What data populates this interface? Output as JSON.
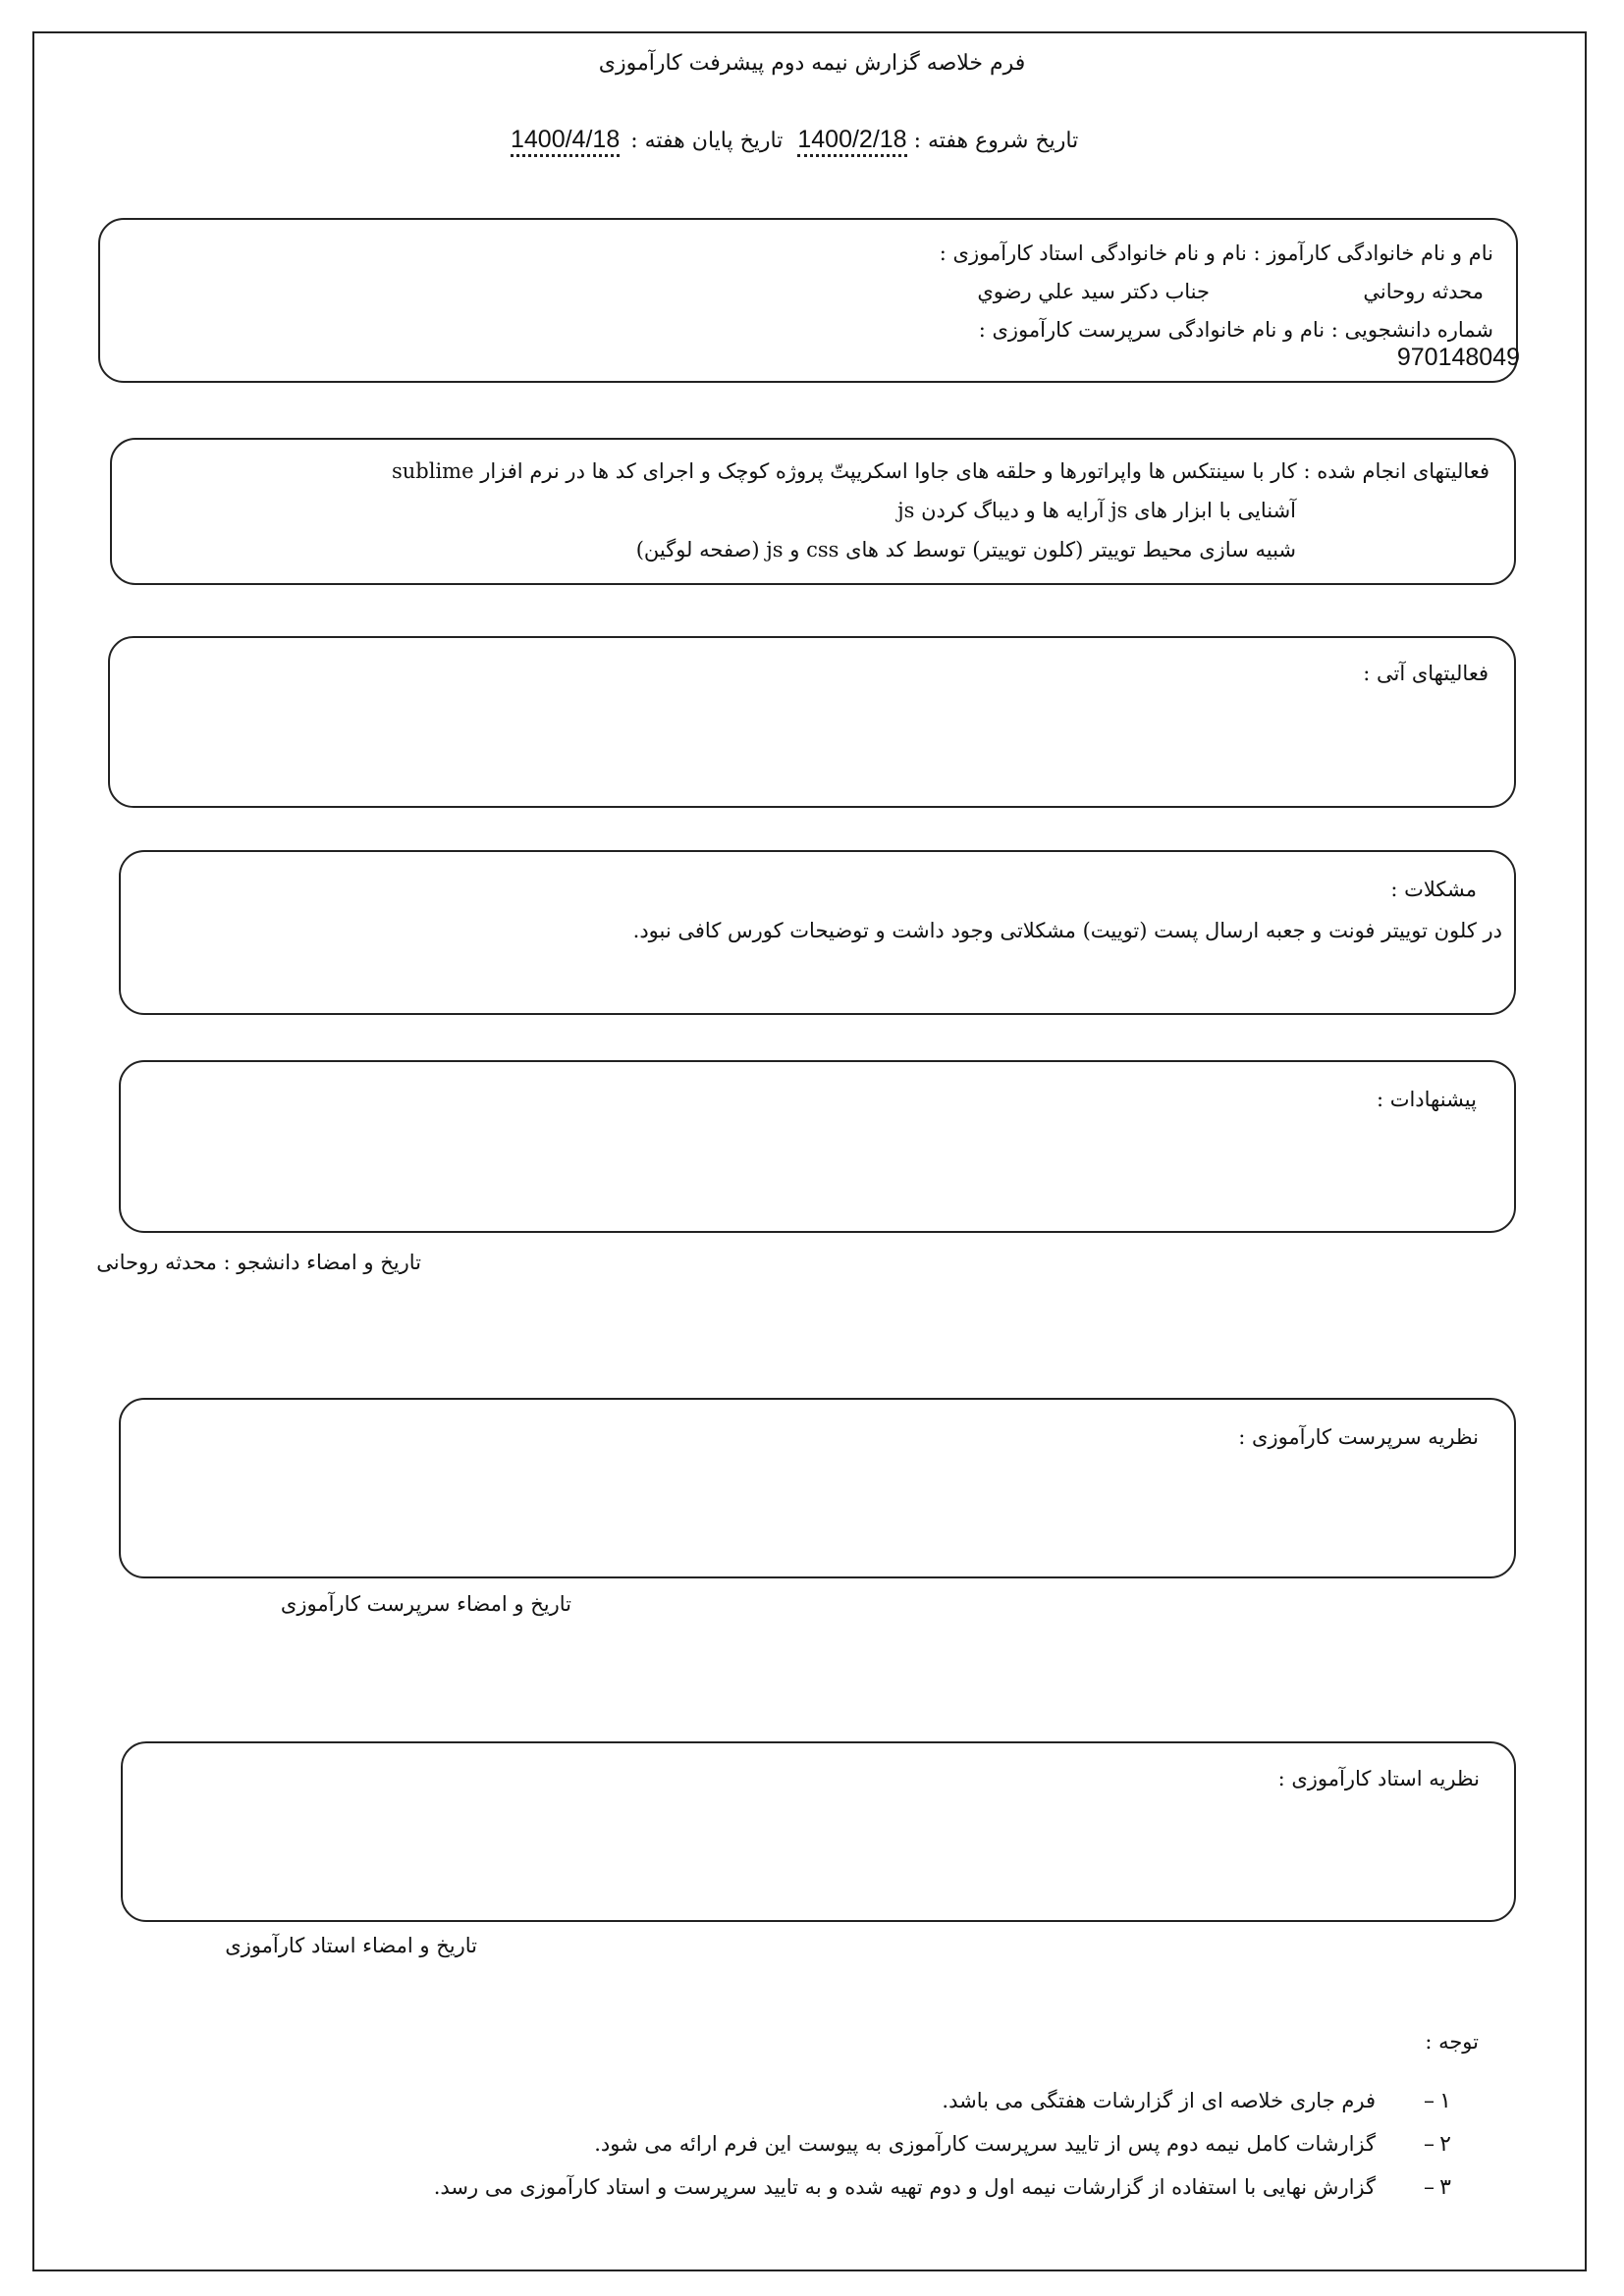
{
  "form": {
    "title": "فرم خلاصه گزارش نیمه دوم پیشرفت کارآموزی",
    "start_label": "تاریخ شروع هفته :",
    "start_date": "1400/2/18",
    "end_label": "تاریخ پایان هفته :",
    "end_date": "1400/4/18"
  },
  "info": {
    "names_label": "نام و نام خانوادگی کارآموز :    نام و نام خانوادگی استاد کارآموزی :",
    "student_name": "محدثه روحاني",
    "professor_name": "جناب دكتر سيد علي رضوي",
    "id_label": "شماره دانشجویی :    نام و نام خانوادگی سرپرست کارآموزی :",
    "student_id": "970148049"
  },
  "activities": {
    "label": "فعالیتهای انجام شده :",
    "line1": "کار با سینتکس ها واپراتورها و حلقه های جاوا اسکریپتّ  پروژه کوچک و اجرای کد ها در نرم افزار sublime",
    "line2": "آشنایی با ابزار های js   آرایه ها و دیباگ کردن js",
    "line3": "شبیه سازی محیط توییتر (کلون توییتر) توسط کد های css و js  (صفحه لوگین)"
  },
  "future": {
    "label": "فعالیتهای آتی :"
  },
  "problems": {
    "label": "مشکلات :",
    "text": "در کلون توییتر فونت و جعبه ارسال پست (توییت) مشکلاتی وجود داشت و توضیحات کورس کافی نبود."
  },
  "suggestions": {
    "label": "پیشنهادات :"
  },
  "student_sign": "تاریخ و امضاء دانشجو : محدثه روحانی",
  "supervisor": {
    "label": "نظریه سرپرست کارآموزی :",
    "sign": "تاریخ و امضاء سرپرست کارآموزی"
  },
  "professor": {
    "label": "نظریه استاد کارآموزی :",
    "sign": "تاریخ  و امضاء استاد کارآموزی"
  },
  "notes": {
    "label": "توجه :",
    "items": [
      {
        "num": "۱",
        "text": "فرم جاری خلاصه ای از گزارشات هفتگی می باشد."
      },
      {
        "num": "۲",
        "text": "گزارشات کامل نیمه دوم  پس از تایید سرپرست کارآموزی به پیوست این فرم ارائه می شود."
      },
      {
        "num": "۳",
        "text": "گزارش نهایی با استفاده از گزارشات نیمه اول و دوم تهیه شده و به تایید سرپرست و استاد کارآموزی می رسد."
      }
    ]
  }
}
